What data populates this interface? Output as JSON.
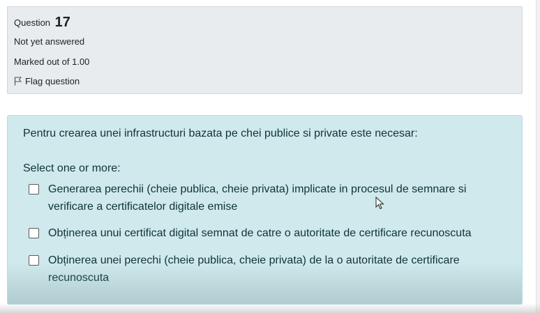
{
  "info": {
    "question_label": "Question",
    "question_number": "17",
    "state": "Not yet answered",
    "grade": "Marked out of 1.00",
    "flag_label": "Flag question"
  },
  "question": {
    "text": "Pentru crearea unei infrastructuri bazata pe chei publice si private este necesar:",
    "prompt": "Select one or more:",
    "answers": [
      {
        "label": "Generarea perechii (cheie publica, cheie privata) implicate in procesul de semnare si verificare a certificatelor digitale emise",
        "checked": false
      },
      {
        "label": "Obținerea unui certificat digital semnat de catre o autoritate de certificare recunoscuta",
        "checked": false
      },
      {
        "label": "Obținerea unei perechi (cheie publica, cheie privata) de la o autoritate de certificare recunoscuta",
        "checked": false
      }
    ]
  },
  "colors": {
    "info_bg": "#e9ecef",
    "formulation_bg": "#cfe9ec",
    "text": "#0f3438"
  }
}
